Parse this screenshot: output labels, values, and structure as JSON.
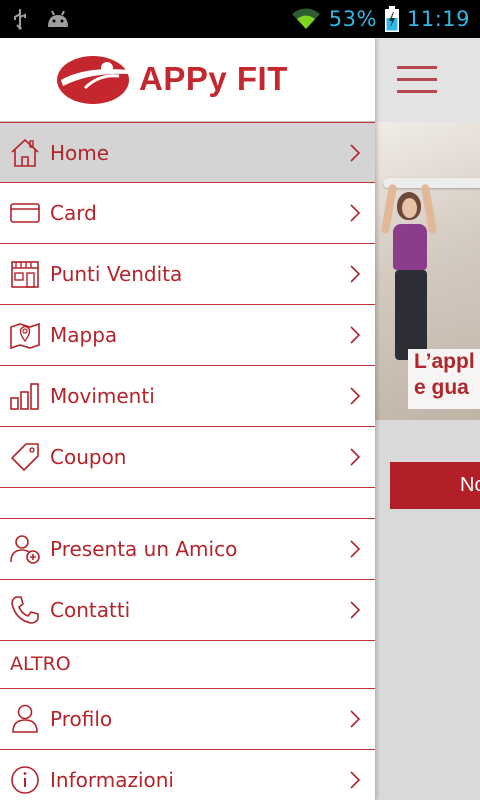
{
  "status_bar": {
    "battery_percent": "53%",
    "time": "11:19",
    "icons": [
      "usb-icon",
      "android-debug-icon",
      "wifi-icon",
      "battery-charging-icon"
    ]
  },
  "app": {
    "logo_text": "APPy FIT",
    "brand_color": "#c4272e"
  },
  "menu": {
    "items": [
      {
        "label": "Home",
        "icon": "home-icon",
        "active": true
      },
      {
        "label": "Card",
        "icon": "card-icon"
      },
      {
        "label": "Punti Vendita",
        "icon": "store-icon"
      },
      {
        "label": "Mappa",
        "icon": "map-icon"
      },
      {
        "label": "Movimenti",
        "icon": "bar-chart-icon"
      },
      {
        "label": "Coupon",
        "icon": "tag-icon"
      }
    ],
    "items2": [
      {
        "label": "Presenta un Amico",
        "icon": "add-user-icon"
      },
      {
        "label": "Contatti",
        "icon": "phone-icon"
      }
    ],
    "section_label": "ALTRO",
    "items3": [
      {
        "label": "Profilo",
        "icon": "user-icon"
      },
      {
        "label": "Informazioni",
        "icon": "info-icon"
      }
    ]
  },
  "background_screen": {
    "hero_caption_line1": "L’appl",
    "hero_caption_line2": "e gua",
    "button_label": "No"
  }
}
